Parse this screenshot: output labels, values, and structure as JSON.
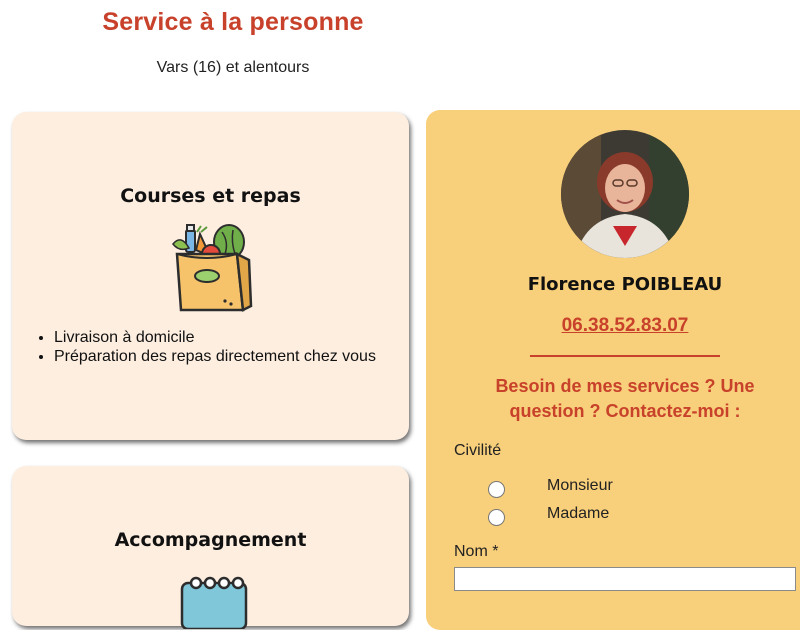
{
  "header": {
    "title": "Service à la personne",
    "subtitle": "Vars (16) et alentours"
  },
  "services": [
    {
      "title": "Courses et repas",
      "icon": "grocery-bag-icon",
      "items": [
        "Livraison à domicile",
        "Préparation des repas directement chez vous"
      ]
    },
    {
      "title": "Accompagnement",
      "icon": "calendar-icon"
    }
  ],
  "contact": {
    "name": "Florence POIBLEAU",
    "phone": "06.38.52.83.07",
    "cta": "Besoin de mes services ? Une question ? Contactez-moi :",
    "form": {
      "civility_label": "Civilité",
      "civility_options": [
        "Monsieur",
        "Madame"
      ],
      "name_label": "Nom *",
      "name_value": ""
    }
  },
  "colors": {
    "accent": "#c8412b",
    "card_bg": "#fdeee0",
    "contact_bg": "#f8cf7a"
  }
}
